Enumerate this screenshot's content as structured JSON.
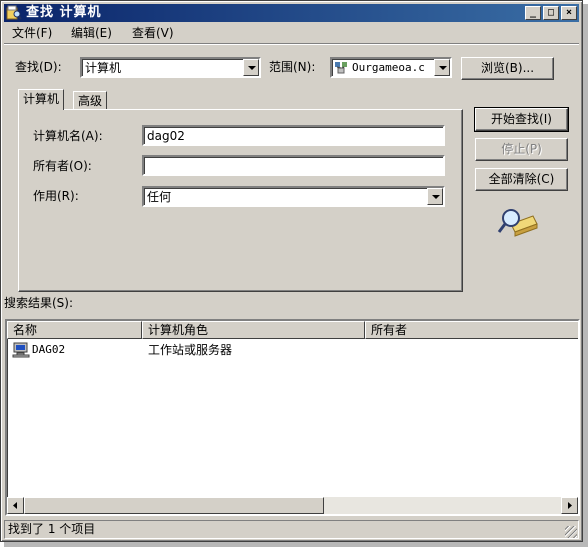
{
  "window": {
    "title": "查找 计算机",
    "controls": {
      "minimize": "_",
      "maximize": "□",
      "close": "×"
    }
  },
  "menu": [
    "文件(F)",
    "编辑(E)",
    "查看(V)"
  ],
  "find": {
    "label": "查找(D):",
    "value": "计算机",
    "scope_label": "范围(N):",
    "scope_value": "Ourgameoa.c",
    "browse_label": "浏览(B)..."
  },
  "tabs": [
    "计算机",
    "高级"
  ],
  "form": {
    "computer_name_label": "计算机名(A):",
    "computer_name_value": "dag02",
    "owner_label": "所有者(O):",
    "owner_value": "",
    "role_label": "作用(R):",
    "role_value": "任何"
  },
  "actions": {
    "start": "开始查找(I)",
    "stop": "停止(P)",
    "clear": "全部清除(C)"
  },
  "results": {
    "label": "搜索结果(S):",
    "columns": [
      "名称",
      "计算机角色",
      "所有者"
    ],
    "rows": [
      {
        "name": "DAG02",
        "role": "工作站或服务器",
        "owner": ""
      }
    ]
  },
  "status": "找到了 1 个项目",
  "colors": {
    "titlebar_start": "#0a246a",
    "titlebar_end": "#3a6ea5",
    "face": "#d4d0c8"
  }
}
